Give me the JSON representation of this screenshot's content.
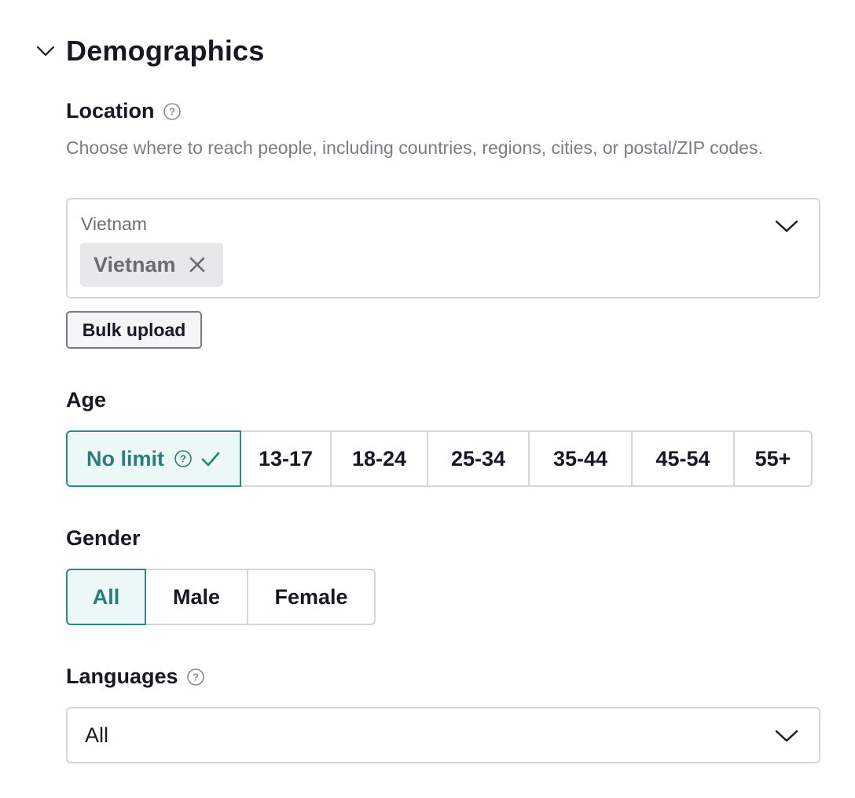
{
  "section": {
    "title": "Demographics",
    "icon": "chevron-down-icon"
  },
  "location": {
    "label": "Location",
    "description": "Choose where to reach people, including countries, regions, cities, or postal/ZIP codes.",
    "input_label": "Vietnam",
    "tags": [
      {
        "label": "Vietnam"
      }
    ],
    "bulk_upload_label": "Bulk upload"
  },
  "age": {
    "label": "Age",
    "options": [
      "No limit",
      "13-17",
      "18-24",
      "25-34",
      "35-44",
      "45-54",
      "55+"
    ],
    "selected": "No limit"
  },
  "gender": {
    "label": "Gender",
    "options": [
      "All",
      "Male",
      "Female"
    ],
    "selected": "All"
  },
  "languages": {
    "label": "Languages",
    "value": "All"
  },
  "colors": {
    "accent": "#2b8a88",
    "accent_bg": "#ebf8f7",
    "text": "#161823",
    "muted": "#7a7c82",
    "border": "#d6d6d9"
  }
}
